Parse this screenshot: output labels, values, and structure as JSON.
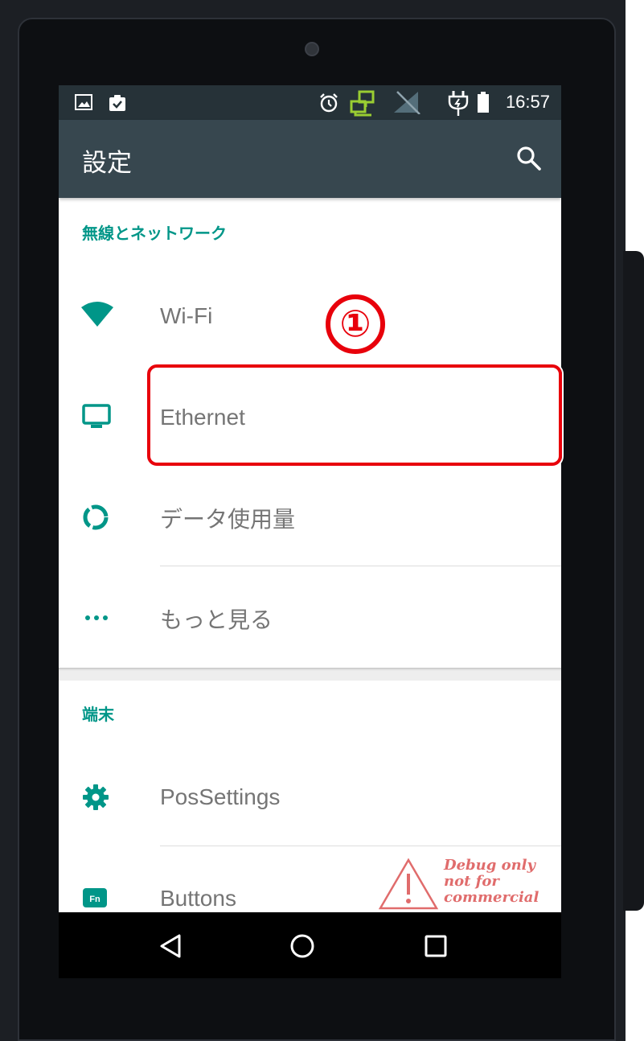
{
  "status_bar": {
    "time": "16:57",
    "left_icons": [
      "image-icon",
      "clipboard-check-icon"
    ],
    "right_icons": [
      "alarm-icon",
      "ethernet-icon",
      "no-signal-icon",
      "charging-icon",
      "battery-icon"
    ],
    "ethernet_icon_color": "#9acd32"
  },
  "app_bar": {
    "title": "設定",
    "search_icon": "search-icon"
  },
  "sections": [
    {
      "header": "無線とネットワーク",
      "items": [
        {
          "label": "Wi-Fi",
          "icon": "wifi-icon"
        },
        {
          "label": "Ethernet",
          "icon": "monitor-icon"
        },
        {
          "label": "データ使用量",
          "icon": "data-usage-icon"
        },
        {
          "label": "もっと見る",
          "icon": "more-icon"
        }
      ]
    },
    {
      "header": "端末",
      "items": [
        {
          "label": "PosSettings",
          "icon": "gear-icon"
        },
        {
          "label": "Buttons",
          "icon": "fn-key-icon"
        }
      ]
    }
  ],
  "annotation": {
    "callout": "①",
    "highlight_color": "#e8000b"
  },
  "watermark": {
    "line1": "Debug only",
    "line2": "not for",
    "line3": "commercial"
  },
  "nav_bar": [
    "back-icon",
    "home-icon",
    "recents-icon"
  ],
  "colors": {
    "accent": "#009688",
    "status_bar": "#263238",
    "app_bar": "#37474f"
  }
}
